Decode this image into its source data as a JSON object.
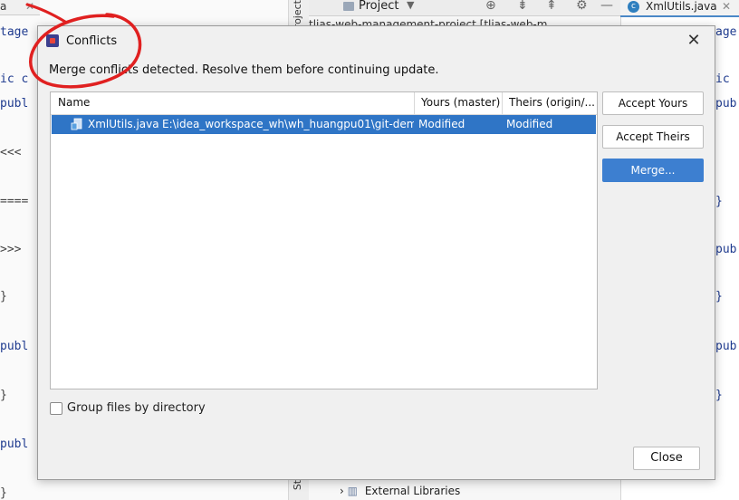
{
  "background": {
    "left_tab_label": "a",
    "left_code": [
      "tage",
      "ic c",
      "publ",
      "<<< ",
      "====",
      ">>> ",
      "}",
      "publ",
      "}",
      "publ",
      "}"
    ],
    "vertical_labels": [
      "Project",
      "Structure"
    ],
    "project_panel": {
      "title": "Project",
      "root_text": "tlias-web-management-project [tlias-web-m",
      "external_libraries": "External Libraries"
    },
    "editor_tab": "XmlUtils.java",
    "right_code": [
      "age",
      "ic",
      "pub",
      "}",
      "pub",
      "}",
      "pub",
      "}"
    ]
  },
  "dialog": {
    "title": "Conflicts",
    "message": "Merge conflicts detected. Resolve them before continuing update.",
    "table": {
      "columns": [
        "Name",
        "Yours (master)",
        "Theirs (origin/..."
      ],
      "rows": [
        {
          "file": "XmlUtils.java",
          "path": "E:\\idea_workspace_wh\\wh_huangpu01\\git-dem",
          "yours": "Modified",
          "theirs": "Modified"
        }
      ]
    },
    "buttons": {
      "accept_yours": "Accept Yours",
      "accept_theirs": "Accept Theirs",
      "merge": "Merge...",
      "close": "Close"
    },
    "group_by_directory": {
      "label": "Group files by directory",
      "checked": false
    }
  },
  "colors": {
    "selection": "#2f75c6",
    "primary_button": "#3d7fd0",
    "annotation": "#e02020"
  }
}
